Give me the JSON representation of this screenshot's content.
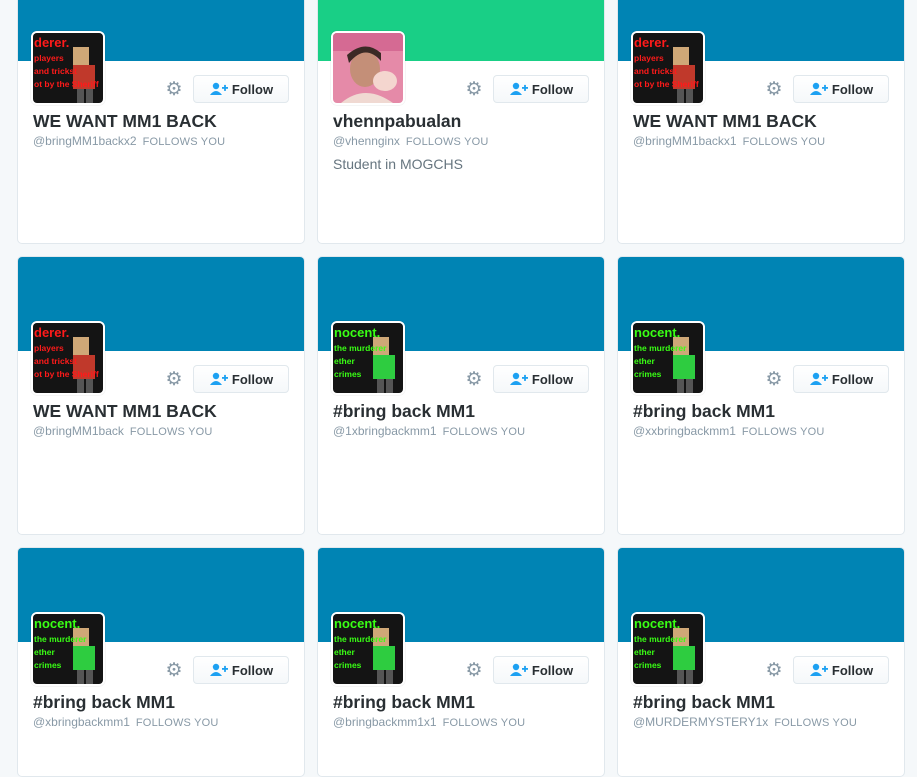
{
  "cards": [
    {
      "name": "WE WANT MM1 BACK",
      "handle": "@bringMM1backx2",
      "follows_you": "FOLLOWS YOU",
      "bio": "",
      "banner_color": "#0084b4",
      "avatar": "red-poster",
      "follow_label": "Follow"
    },
    {
      "name": "vhennpabualan",
      "handle": "@vhennginx",
      "follows_you": "FOLLOWS YOU",
      "bio": "Student in MOGCHS",
      "banner_color": "#19cf86",
      "avatar": "photo",
      "follow_label": "Follow"
    },
    {
      "name": "WE WANT MM1 BACK",
      "handle": "@bringMM1backx1",
      "follows_you": "FOLLOWS YOU",
      "bio": "",
      "banner_color": "#0084b4",
      "avatar": "red-poster",
      "follow_label": "Follow"
    },
    {
      "name": "WE WANT MM1 BACK",
      "handle": "@bringMM1back",
      "follows_you": "FOLLOWS YOU",
      "bio": "",
      "banner_color": "#0084b4",
      "avatar": "red-poster",
      "follow_label": "Follow"
    },
    {
      "name": "#bring back MM1",
      "handle": "@1xbringbackmm1",
      "follows_you": "FOLLOWS YOU",
      "bio": "",
      "banner_color": "#0084b4",
      "avatar": "green-poster",
      "follow_label": "Follow"
    },
    {
      "name": "#bring back MM1",
      "handle": "@xxbringbackmm1",
      "follows_you": "FOLLOWS YOU",
      "bio": "",
      "banner_color": "#0084b4",
      "avatar": "green-poster",
      "follow_label": "Follow"
    },
    {
      "name": "#bring back MM1",
      "handle": "@xbringbackmm1",
      "follows_you": "FOLLOWS YOU",
      "bio": "",
      "banner_color": "#0084b4",
      "avatar": "green-poster",
      "follow_label": "Follow"
    },
    {
      "name": "#bring back MM1",
      "handle": "@bringbackmm1x1",
      "follows_you": "FOLLOWS YOU",
      "bio": "",
      "banner_color": "#0084b4",
      "avatar": "green-poster",
      "follow_label": "Follow"
    },
    {
      "name": "#bring back MM1",
      "handle": "@MURDERMYSTERY1x",
      "follows_you": "FOLLOWS YOU",
      "bio": "",
      "banner_color": "#0084b4",
      "avatar": "green-poster",
      "follow_label": "Follow"
    }
  ],
  "avatar_texts": {
    "red-poster": [
      "derer.",
      "players",
      "and trickst",
      "ot by the Sheriff"
    ],
    "green-poster": [
      "nocent.",
      "the murderer",
      "ether",
      "crimes"
    ]
  },
  "icons": {
    "settings": "gear-icon",
    "follow": "add-user-icon"
  },
  "colors": {
    "accent_red": "#e0245e",
    "red_text": "#ff1a1a",
    "green_text": "#39ff14"
  }
}
